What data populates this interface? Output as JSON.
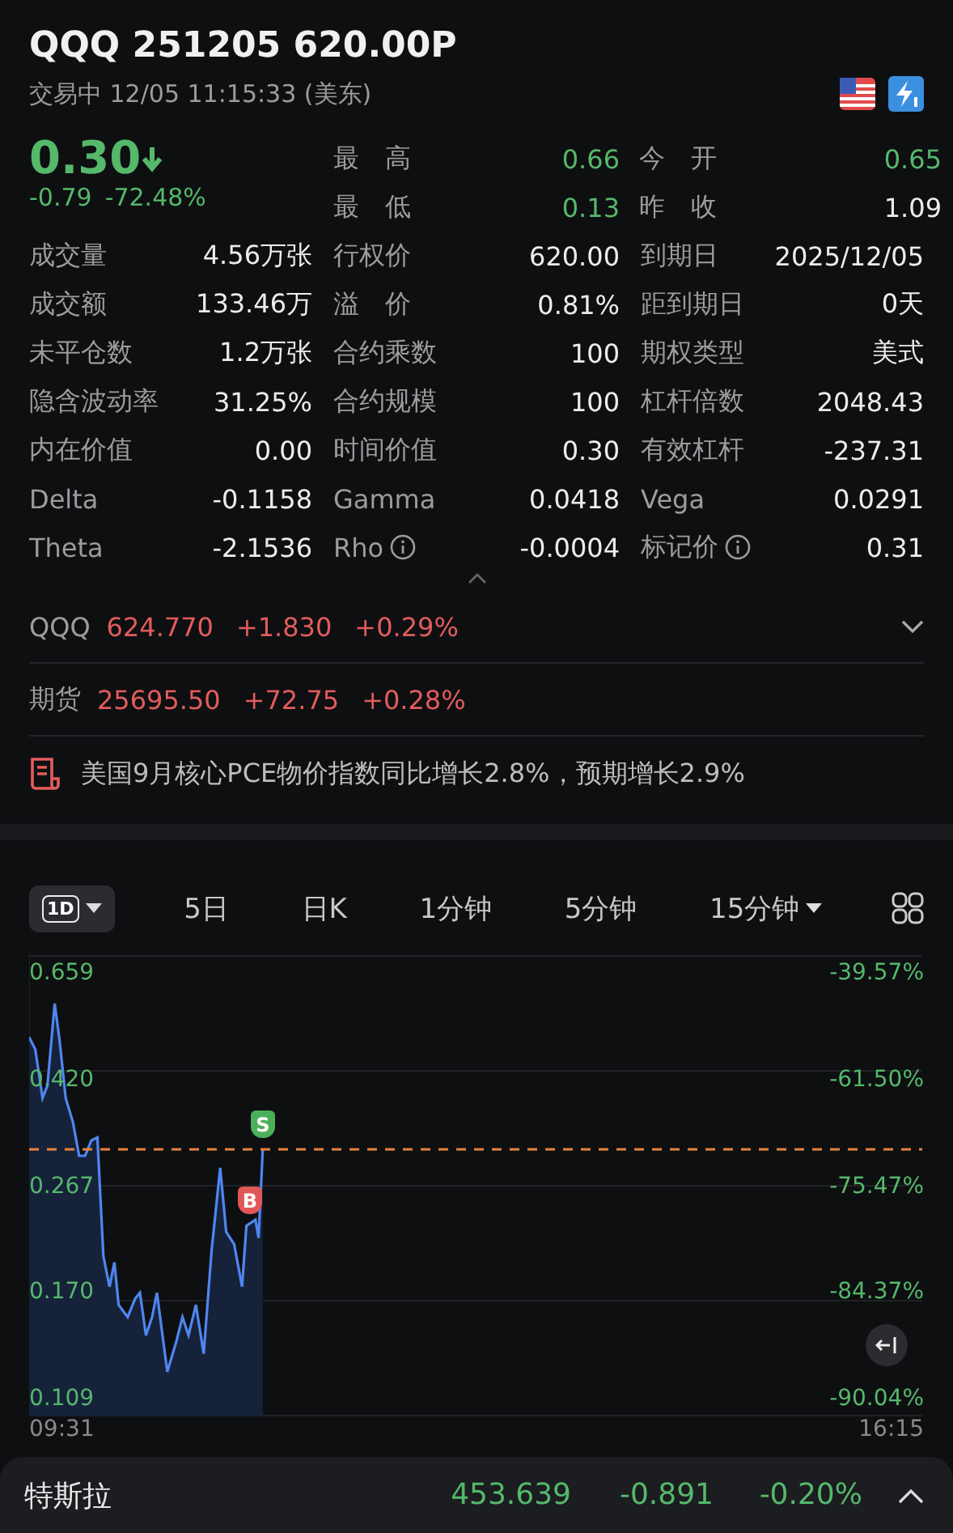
{
  "header": {
    "title": "QQQ 251205 620.00P",
    "status": "交易中 12/05 11:15:33 (美东)"
  },
  "quote": {
    "price": "0.30",
    "change": "-0.79",
    "change_pct": "-72.48%",
    "falling": true
  },
  "stats": [
    [
      {
        "label": "最　高",
        "value": "0.66",
        "highlighted": true
      },
      {
        "label": "今　开",
        "value": "0.65",
        "highlighted": true
      }
    ],
    [
      {
        "label": "最　低",
        "value": "0.13",
        "highlighted": true
      },
      {
        "label": "昨　收",
        "value": "1.09",
        "highlighted": false
      }
    ]
  ],
  "grid": [
    [
      {
        "label": "成交量",
        "value": "4.56万张"
      },
      {
        "label": "行权价",
        "value": "620.00"
      },
      {
        "label": "到期日",
        "value": "2025/12/05"
      }
    ],
    [
      {
        "label": "成交额",
        "value": "133.46万"
      },
      {
        "label": "溢　价",
        "value": "0.81%"
      },
      {
        "label": "距到期日",
        "value": "0天"
      }
    ],
    [
      {
        "label": "未平仓数",
        "value": "1.2万张"
      },
      {
        "label": "合约乘数",
        "value": "100"
      },
      {
        "label": "期权类型",
        "value": "美式"
      }
    ],
    [
      {
        "label": "隐含波动率",
        "value": "31.25%"
      },
      {
        "label": "合约规模",
        "value": "100"
      },
      {
        "label": "杠杆倍数",
        "value": "2048.43"
      }
    ],
    [
      {
        "label": "内在价值",
        "value": "0.00"
      },
      {
        "label": "时间价值",
        "value": "0.30"
      },
      {
        "label": "有效杠杆",
        "value": "-237.31"
      }
    ],
    [
      {
        "label": "Delta",
        "value": "-0.1158"
      },
      {
        "label": "Gamma",
        "value": "0.0418"
      },
      {
        "label": "Vega",
        "value": "0.0291"
      }
    ],
    [
      {
        "label": "Theta",
        "value": "-2.1536"
      },
      {
        "label": "Rho",
        "value": "-0.0004",
        "info": true
      },
      {
        "label": "标记价",
        "value": "0.31",
        "info": true
      }
    ]
  ],
  "underlyings": [
    {
      "name": "QQQ",
      "price": "624.770",
      "change": "+1.830",
      "change_pct": "+0.29%",
      "expandable": true
    },
    {
      "name": "期货",
      "price": "25695.50",
      "change": "+72.75",
      "change_pct": "+0.28%",
      "expandable": false
    }
  ],
  "news": "美国9月核心PCE物价指数同比增长2.8%，预期增长2.9%",
  "periods": [
    {
      "label": "1D",
      "selected": true,
      "kind": "badge"
    },
    {
      "label": "5日",
      "selected": false,
      "kind": "text"
    },
    {
      "label": "日K",
      "selected": false,
      "kind": "text"
    },
    {
      "label": "1分钟",
      "selected": false,
      "kind": "text"
    },
    {
      "label": "5分钟",
      "selected": false,
      "kind": "text"
    },
    {
      "label": "15分钟",
      "selected": false,
      "kind": "menu"
    }
  ],
  "chart": {
    "left_axis": [
      "0.659",
      "0.420",
      "0.267",
      "0.170",
      "0.109"
    ],
    "right_axis": [
      "-39.57%",
      "-61.50%",
      "-75.47%",
      "-84.37%",
      "-90.04%"
    ],
    "start_time": "09:31",
    "end_time": "16:15",
    "markers": [
      {
        "label": "S",
        "kind": "sell"
      },
      {
        "label": "B",
        "kind": "buy"
      }
    ]
  },
  "footer": {
    "name": "特斯拉",
    "price": "453.639",
    "change": "-0.891",
    "change_pct": "-0.20%"
  }
}
